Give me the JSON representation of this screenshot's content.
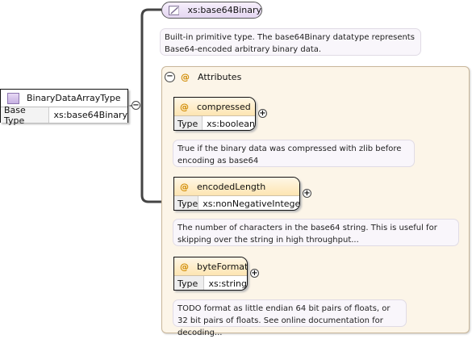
{
  "root": {
    "name": "BinaryDataArrayType",
    "base_type_label": "Base Type",
    "base_type_value": "xs:base64Binary"
  },
  "base_type_node": {
    "name": "xs:base64Binary",
    "documentation": "Built-in primitive type. The base64Binary datatype represents Base64-encoded arbitrary binary data."
  },
  "attributes_group": {
    "title": "Attributes",
    "toggle": "−",
    "items": [
      {
        "name": "compressed",
        "type_label": "Type",
        "type_value": "xs:boolean",
        "documentation": "True if the binary data was compressed with zlib before encoding as base64"
      },
      {
        "name": "encodedLength",
        "type_label": "Type",
        "type_value": "xs:nonNegativeInteger",
        "documentation": "The number of characters in the base64 string. This is useful for skipping over the string in high throughput..."
      },
      {
        "name": "byteFormat",
        "type_label": "Type",
        "type_value": "xs:string",
        "documentation": "TODO format as little endian 64 bit pairs of floats, or 32 bit pairs of floats. See online documentation for decoding..."
      }
    ]
  },
  "glyphs": {
    "at": "@",
    "collapse": "−",
    "expand": "+"
  },
  "colors": {
    "type_fill": "#c6b0e2",
    "attr_fill": "#fde5b2",
    "group_fill": "#fcf5e8",
    "at_symbol": "#d08a00"
  }
}
